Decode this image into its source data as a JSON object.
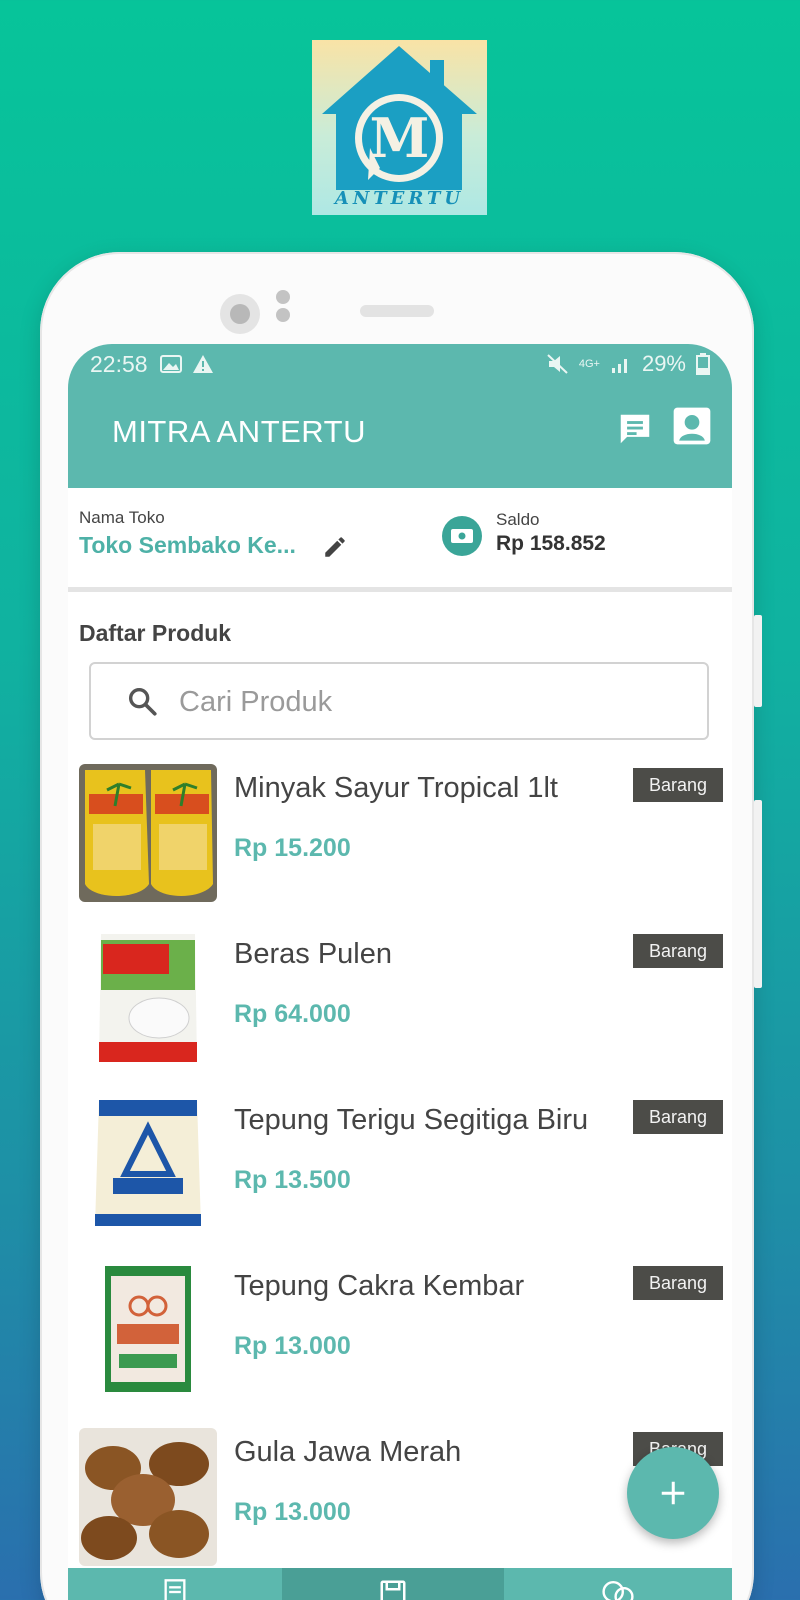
{
  "logo": {
    "letter": "M",
    "word": "ANTERTU"
  },
  "status_bar": {
    "time": "22:58",
    "network": "4G+",
    "battery": "29%"
  },
  "app_bar": {
    "title": "MITRA ANTERTU",
    "icons": [
      "chat-icon",
      "account-icon"
    ]
  },
  "store": {
    "name_label": "Nama Toko",
    "name_value": "Toko Sembako Ke...",
    "balance_label": "Saldo",
    "balance_value": "Rp 158.852"
  },
  "products_section": {
    "title": "Daftar Produk",
    "search_placeholder": "Cari Produk"
  },
  "products": [
    {
      "name": "Minyak Sayur Tropical 1lt",
      "price": "Rp 15.200",
      "badge": "Barang"
    },
    {
      "name": "Beras Pulen",
      "price": "Rp 64.000",
      "badge": "Barang"
    },
    {
      "name": "Tepung Terigu Segitiga Biru",
      "price": "Rp 13.500",
      "badge": "Barang"
    },
    {
      "name": "Tepung Cakra Kembar",
      "price": "Rp 13.000",
      "badge": "Barang"
    },
    {
      "name": "Gula Jawa Merah",
      "price": "Rp 13.000",
      "badge": "Barang"
    }
  ],
  "bottom_nav": {
    "active_index": 1,
    "icons": [
      "orders-icon",
      "save-icon",
      "chat-bubbles-icon"
    ]
  },
  "colors": {
    "primary": "#5cb8ae",
    "badge": "#4c4c48",
    "background_top": "#07c49a",
    "background_bottom": "#2a6fae"
  }
}
